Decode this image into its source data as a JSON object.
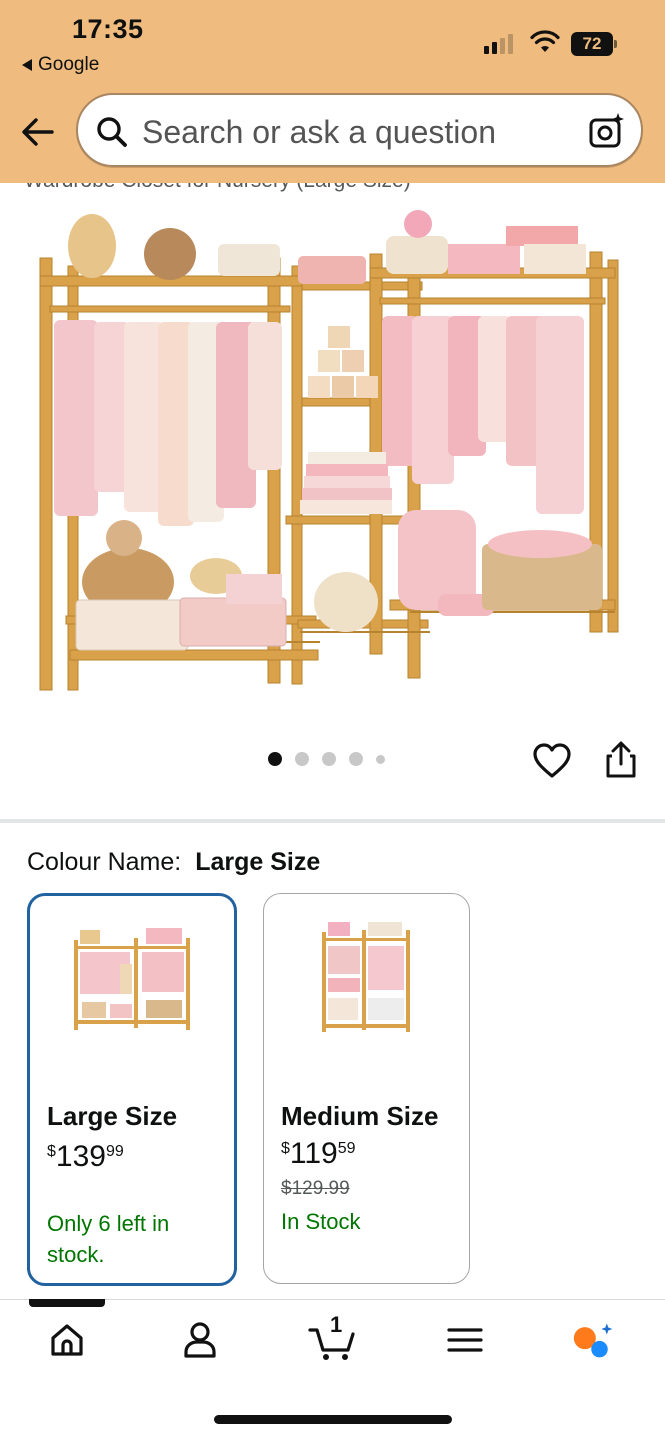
{
  "status_bar": {
    "time": "17:35",
    "back_to_app": "Google",
    "battery": "72",
    "icons": [
      "cellular-signal-icon",
      "wifi-icon",
      "battery-icon"
    ]
  },
  "header": {
    "back_icon": "arrow-left-icon",
    "search_placeholder": "Search or ask a question",
    "search_icon": "search-icon",
    "camera_icon": "camera-lens-icon"
  },
  "product": {
    "title_fragment": "Wardrobe Closet for Nursery (Large Size)",
    "image_count": 5,
    "active_image_index": 0,
    "favorite_icon": "heart-icon",
    "share_icon": "share-icon"
  },
  "variants": {
    "label": "Colour Name:",
    "selected_value": "Large Size",
    "options": [
      {
        "name": "Large Size",
        "price_currency": "$",
        "price_whole": "139",
        "price_cents": "99",
        "was_price": "",
        "stock_line1": "Only 6 left in",
        "stock_line2": "stock.",
        "selected": true
      },
      {
        "name": "Medium Size",
        "price_currency": "$",
        "price_whole": "119",
        "price_cents": "59",
        "was_price": "$129.99",
        "stock_line1": "In Stock",
        "stock_line2": "",
        "selected": false
      }
    ]
  },
  "bottom_nav": {
    "items": [
      "home-icon",
      "account-icon",
      "cart-icon",
      "menu-icon",
      "rufus-assistant-icon"
    ],
    "cart_count": "1",
    "active": "home"
  },
  "colors": {
    "header_bg": "#efbb7e",
    "selected_border": "#2162a1",
    "in_stock_green": "#007600",
    "wood": "#d9a24a",
    "pink": "#f2b6bd"
  }
}
